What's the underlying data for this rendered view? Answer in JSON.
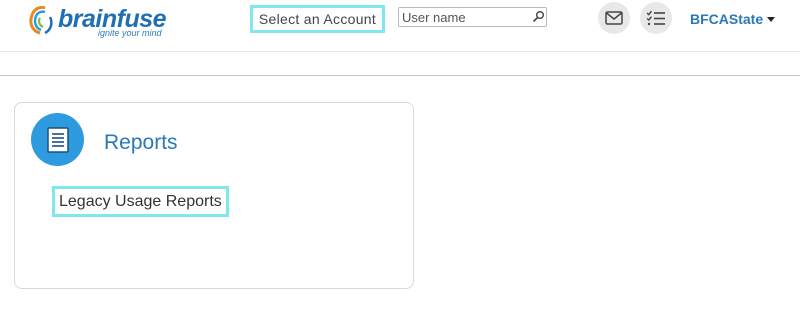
{
  "header": {
    "logo": {
      "name": "brainfuse",
      "tagline": "ignite your mind"
    },
    "account_select": {
      "selected": "Select an Account"
    },
    "username": {
      "placeholder": "User name",
      "value": ""
    },
    "icons": {
      "mail": "envelope-icon",
      "tasks": "checklist-icon",
      "search": "search-icon"
    },
    "user_menu": {
      "label": "BFCAState"
    }
  },
  "main": {
    "card": {
      "title": "Reports",
      "icon": "document-icon",
      "links": [
        {
          "label": "Legacy Usage Reports"
        }
      ]
    }
  },
  "colors": {
    "brand": "#1f6fb4",
    "link": "#2a78b8",
    "icon_circle": "#2e9be0",
    "highlight": "#7de8ee"
  }
}
